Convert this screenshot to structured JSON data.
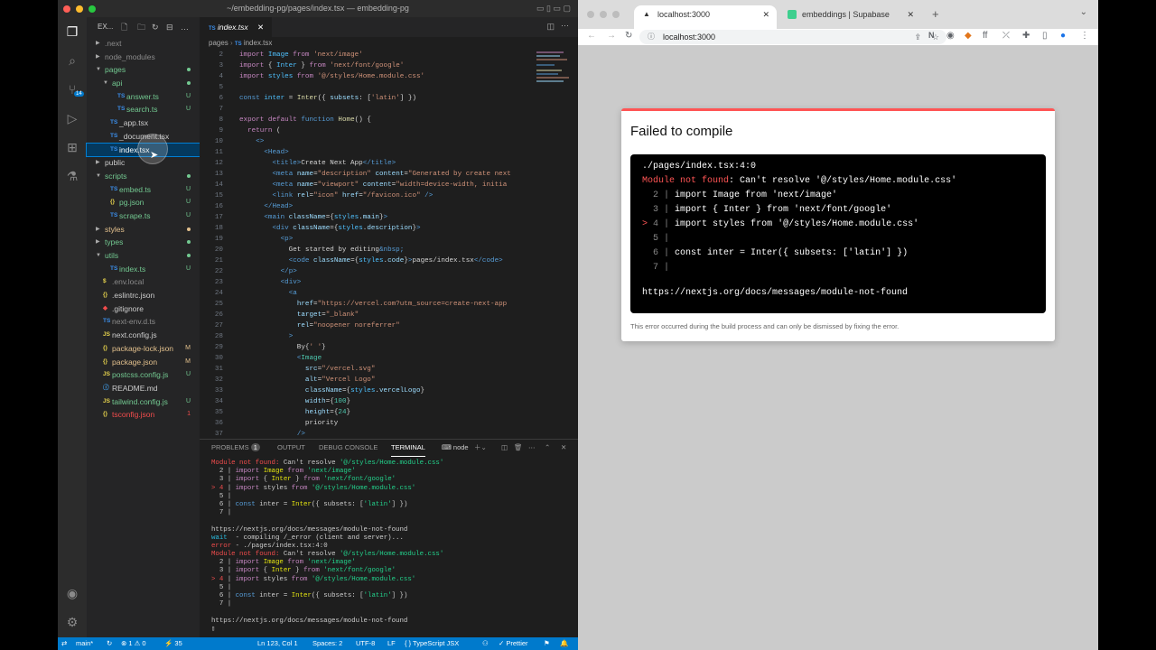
{
  "vscode": {
    "window_title": "~/embedding-pg/pages/index.tsx — embedding-pg",
    "explorer_label": "EX...",
    "scm_badge": "14",
    "tree": [
      {
        "name": ".next",
        "type": "folder",
        "open": false,
        "indent": 0,
        "color": "#8b8b8b"
      },
      {
        "name": "node_modules",
        "type": "folder",
        "open": false,
        "indent": 0,
        "color": "#8b8b8b"
      },
      {
        "name": "pages",
        "type": "folder",
        "open": true,
        "indent": 0,
        "color": "#73c991",
        "dot": "#73c991"
      },
      {
        "name": "api",
        "type": "folder",
        "open": true,
        "indent": 1,
        "color": "#73c991",
        "dot": "#73c991"
      },
      {
        "name": "answer.ts",
        "type": "ts",
        "indent": 2,
        "color": "#73c991",
        "status": "U"
      },
      {
        "name": "search.ts",
        "type": "ts",
        "indent": 2,
        "color": "#73c991",
        "status": "U"
      },
      {
        "name": "_app.tsx",
        "type": "tsx",
        "indent": 1,
        "color": "#cccccc"
      },
      {
        "name": "_document.tsx",
        "type": "tsx",
        "indent": 1,
        "color": "#cccccc"
      },
      {
        "name": "index.tsx",
        "type": "tsx",
        "indent": 1,
        "color": "#ffffff",
        "selected": true
      },
      {
        "name": "public",
        "type": "folder",
        "open": false,
        "indent": 0,
        "color": "#cccccc"
      },
      {
        "name": "scripts",
        "type": "folder",
        "open": true,
        "indent": 0,
        "color": "#73c991",
        "dot": "#73c991"
      },
      {
        "name": "embed.ts",
        "type": "ts",
        "indent": 1,
        "color": "#73c991",
        "status": "U"
      },
      {
        "name": "pg.json",
        "type": "json",
        "indent": 1,
        "color": "#73c991",
        "status": "U"
      },
      {
        "name": "scrape.ts",
        "type": "ts",
        "indent": 1,
        "color": "#73c991",
        "status": "U"
      },
      {
        "name": "styles",
        "type": "folder",
        "open": false,
        "indent": 0,
        "color": "#e2c08d",
        "dot": "#e2c08d"
      },
      {
        "name": "types",
        "type": "folder",
        "open": false,
        "indent": 0,
        "color": "#73c991",
        "dot": "#73c991"
      },
      {
        "name": "utils",
        "type": "folder",
        "open": true,
        "indent": 0,
        "color": "#73c991",
        "dot": "#73c991"
      },
      {
        "name": "index.ts",
        "type": "ts",
        "indent": 1,
        "color": "#73c991",
        "status": "U"
      },
      {
        "name": ".env.local",
        "type": "env",
        "indent": 0,
        "color": "#8b8b8b"
      },
      {
        "name": ".eslintrc.json",
        "type": "json",
        "indent": 0,
        "color": "#cccccc"
      },
      {
        "name": ".gitignore",
        "type": "git",
        "indent": 0,
        "color": "#cccccc"
      },
      {
        "name": "next-env.d.ts",
        "type": "ts",
        "indent": 0,
        "color": "#8b8b8b"
      },
      {
        "name": "next.config.js",
        "type": "js",
        "indent": 0,
        "color": "#cccccc"
      },
      {
        "name": "package-lock.json",
        "type": "json",
        "indent": 0,
        "color": "#e2c08d",
        "status": "M"
      },
      {
        "name": "package.json",
        "type": "json",
        "indent": 0,
        "color": "#e2c08d",
        "status": "M"
      },
      {
        "name": "postcss.config.js",
        "type": "js",
        "indent": 0,
        "color": "#73c991",
        "status": "U"
      },
      {
        "name": "README.md",
        "type": "md",
        "indent": 0,
        "color": "#cccccc"
      },
      {
        "name": "tailwind.config.js",
        "type": "js",
        "indent": 0,
        "color": "#73c991",
        "status": "U"
      },
      {
        "name": "tsconfig.json",
        "type": "json",
        "indent": 0,
        "color": "#f14c4c",
        "status": "1"
      }
    ],
    "editor_tab": "index.tsx",
    "breadcrumb_folder": "pages",
    "breadcrumb_file": "index.tsx",
    "code_lines": [
      {
        "n": "2",
        "html": "<span class=\"kw\">import</span> <span class=\"vr\">Image</span> <span class=\"kw\">from</span> <span class=\"str\">'next/image'</span>"
      },
      {
        "n": "3",
        "html": "<span class=\"kw\">import</span> { <span class=\"vr\">Inter</span> } <span class=\"kw\">from</span> <span class=\"str\">'next/font/google'</span>"
      },
      {
        "n": "4",
        "html": "<span class=\"kw\">import</span> <span class=\"vr\">styles</span> <span class=\"kw\">from</span> <span class=\"str\">'@/styles/Home.module.css'</span>"
      },
      {
        "n": "5",
        "html": ""
      },
      {
        "n": "6",
        "html": "<span class=\"tag\">const</span> <span class=\"vr\">inter</span> = <span class=\"fn\">Inter</span>({ <span class=\"at\">subsets</span>: [<span class=\"str\">'latin'</span>] })"
      },
      {
        "n": "7",
        "html": ""
      },
      {
        "n": "8",
        "html": "<span class=\"kw\">export default</span> <span class=\"tag\">function</span> <span class=\"fn\">Home</span>() {"
      },
      {
        "n": "9",
        "html": "  <span class=\"kw\">return</span> ("
      },
      {
        "n": "10",
        "html": "    <span class=\"tag\">&lt;&gt;</span>"
      },
      {
        "n": "11",
        "html": "      <span class=\"tag\">&lt;Head&gt;</span>"
      },
      {
        "n": "12",
        "html": "        <span class=\"tag\">&lt;title&gt;</span>Create Next App<span class=\"tag\">&lt;/title&gt;</span>"
      },
      {
        "n": "13",
        "html": "        <span class=\"tag\">&lt;meta</span> <span class=\"at\">name</span>=<span class=\"str\">\"description\"</span> <span class=\"at\">content</span>=<span class=\"str\">\"Generated by create next</span>"
      },
      {
        "n": "14",
        "html": "        <span class=\"tag\">&lt;meta</span> <span class=\"at\">name</span>=<span class=\"str\">\"viewport\"</span> <span class=\"at\">content</span>=<span class=\"str\">\"width=device-width, initia</span>"
      },
      {
        "n": "15",
        "html": "        <span class=\"tag\">&lt;link</span> <span class=\"at\">rel</span>=<span class=\"str\">\"icon\"</span> <span class=\"at\">href</span>=<span class=\"str\">\"/favicon.ico\"</span> <span class=\"tag\">/&gt;</span>"
      },
      {
        "n": "16",
        "html": "      <span class=\"tag\">&lt;/Head&gt;</span>"
      },
      {
        "n": "17",
        "html": "      <span class=\"tag\">&lt;main</span> <span class=\"at\">className</span>={<span class=\"vr\">styles</span>.<span class=\"at\">main</span>}<span class=\"tag\">&gt;</span>"
      },
      {
        "n": "18",
        "html": "        <span class=\"tag\">&lt;div</span> <span class=\"at\">className</span>={<span class=\"vr\">styles</span>.<span class=\"at\">description</span>}<span class=\"tag\">&gt;</span>"
      },
      {
        "n": "19",
        "html": "          <span class=\"tag\">&lt;p&gt;</span>"
      },
      {
        "n": "20",
        "html": "            Get started by editing<span class=\"tag\">&amp;nbsp;</span>"
      },
      {
        "n": "21",
        "html": "            <span class=\"tag\">&lt;code</span> <span class=\"at\">className</span>={<span class=\"vr\">styles</span>.<span class=\"at\">code</span>}<span class=\"tag\">&gt;</span>pages/index.tsx<span class=\"tag\">&lt;/code&gt;</span>"
      },
      {
        "n": "22",
        "html": "          <span class=\"tag\">&lt;/p&gt;</span>"
      },
      {
        "n": "23",
        "html": "          <span class=\"tag\">&lt;div&gt;</span>"
      },
      {
        "n": "24",
        "html": "            <span class=\"tag\">&lt;a</span>"
      },
      {
        "n": "25",
        "html": "              <span class=\"at\">href</span>=<span class=\"str\">\"https://vercel.com?utm_source=create-next-app</span>"
      },
      {
        "n": "26",
        "html": "              <span class=\"at\">target</span>=<span class=\"str\">\"_blank\"</span>"
      },
      {
        "n": "27",
        "html": "              <span class=\"at\">rel</span>=<span class=\"str\">\"noopener noreferrer\"</span>"
      },
      {
        "n": "28",
        "html": "            <span class=\"tag\">&gt;</span>"
      },
      {
        "n": "29",
        "html": "              By{<span class=\"str\">' '</span>}"
      },
      {
        "n": "30",
        "html": "              <span class=\"tag\">&lt;</span><span class=\"ty\">Image</span>"
      },
      {
        "n": "31",
        "html": "                <span class=\"at\">src</span>=<span class=\"str\">\"/vercel.svg\"</span>"
      },
      {
        "n": "32",
        "html": "                <span class=\"at\">alt</span>=<span class=\"str\">\"Vercel Logo\"</span>"
      },
      {
        "n": "33",
        "html": "                <span class=\"at\">className</span>={<span class=\"vr\">styles</span>.<span class=\"at\">vercelLogo</span>}"
      },
      {
        "n": "34",
        "html": "                <span class=\"at\">width</span>={<span class=\"ty\">100</span>}"
      },
      {
        "n": "35",
        "html": "                <span class=\"at\">height</span>={<span class=\"ty\">24</span>}"
      },
      {
        "n": "36",
        "html": "                priority"
      },
      {
        "n": "37",
        "html": "              <span class=\"tag\">/&gt;</span>"
      }
    ],
    "panel_tabs": {
      "problems": "PROBLEMS",
      "problems_count": "1",
      "output": "OUTPUT",
      "debug": "DEBUG CONSOLE",
      "terminal": "TERMINAL",
      "shell": "node"
    },
    "terminal_lines": [
      "<span class=\"red\">Module not found:</span> Can't resolve <span class=\"grn\">'@/styles/Home.module.css'</span>",
      "  2 | <span class=\"kw\">import</span> <span class=\"yel\">Image</span> <span class=\"kw\">from</span> <span class=\"grn\">'next/image'</span>",
      "  3 | <span class=\"kw\">import</span> { <span class=\"yel\">Inter</span> } <span class=\"kw\">from</span> <span class=\"grn\">'next/font/google'</span>",
      "<span class=\"red\">&gt; 4</span> | <span class=\"kw\">import</span> styles <span class=\"kw\">from</span> <span class=\"grn\">'@/styles/Home.module.css'</span>",
      "  5 |",
      "  6 | <span class=\"tag\">const</span> inter = <span class=\"yel\">Inter</span>({ subsets: [<span class=\"grn\">'latin'</span>] })",
      "  7 |",
      "",
      "https://nextjs.org/docs/messages/module-not-found",
      "<span class=\"cyan\">wait</span>  - compiling /_error (client and server)...",
      "<span class=\"red\">error</span> - ./pages/index.tsx:4:0",
      "<span class=\"red\">Module not found:</span> Can't resolve <span class=\"grn\">'@/styles/Home.module.css'</span>",
      "  2 | <span class=\"kw\">import</span> <span class=\"yel\">Image</span> <span class=\"kw\">from</span> <span class=\"grn\">'next/image'</span>",
      "  3 | <span class=\"kw\">import</span> { <span class=\"yel\">Inter</span> } <span class=\"kw\">from</span> <span class=\"grn\">'next/font/google'</span>",
      "<span class=\"red\">&gt; 4</span> | <span class=\"kw\">import</span> styles <span class=\"kw\">from</span> <span class=\"grn\">'@/styles/Home.module.css'</span>",
      "  5 |",
      "  6 | <span class=\"tag\">const</span> inter = <span class=\"yel\">Inter</span>({ subsets: [<span class=\"grn\">'latin'</span>] })",
      "  7 |",
      "",
      "https://nextjs.org/docs/messages/module-not-found",
      "▯"
    ],
    "status": {
      "branch": "main*",
      "errors": "⊗ 1 ⚠ 0",
      "ports": "⚡ 35",
      "position": "Ln 123, Col 1",
      "spaces": "Spaces: 2",
      "encoding": "UTF-8",
      "eol": "LF",
      "language": "{ } TypeScript JSX",
      "prettier": "✓ Prettier"
    }
  },
  "chrome": {
    "tabs": [
      {
        "title": "localhost:3000",
        "active": true
      },
      {
        "title": "embeddings | Supabase",
        "active": false
      }
    ],
    "url": "localhost:3000",
    "error": {
      "title": "Failed to compile",
      "path": "./pages/index.tsx:4:0",
      "lines": [
        "<span style=\"color:#ff5555\">Module not found</span>: Can't resolve '<span style=\"color:#fff\">@/styles/Home.module.css</span>'",
        "  <span style=\"color:#888\">2 |</span> import Image from 'next/image'",
        "  <span style=\"color:#888\">3 |</span> import { Inter } from 'next/font/google'",
        "<span style=\"color:#ff5555\">&gt;</span> <span style=\"color:#888\">4 |</span> import styles from '@/styles/Home.module.css'",
        "  <span style=\"color:#888\">5 |</span>",
        "  <span style=\"color:#888\">6 |</span> const inter = Inter({ subsets: ['latin'] })",
        "  <span style=\"color:#888\">7 |</span>",
        "",
        "https://nextjs.org/docs/messages/module-not-found"
      ],
      "footer": "This error occurred during the build process and can only be dismissed by fixing the error."
    }
  }
}
